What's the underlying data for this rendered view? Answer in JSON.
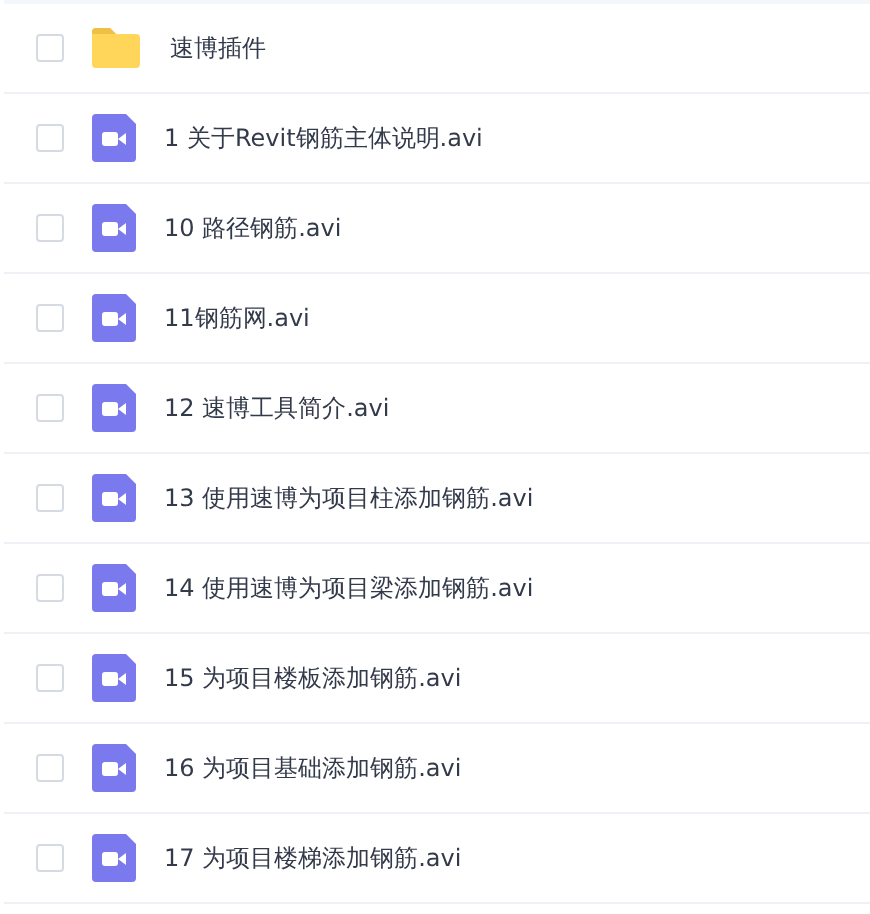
{
  "files": [
    {
      "kind": "folder",
      "name": "速博插件",
      "checked": false
    },
    {
      "kind": "video",
      "name": "1 关于Revit钢筋主体说明.avi",
      "checked": false
    },
    {
      "kind": "video",
      "name": "10 路径钢筋.avi",
      "checked": false
    },
    {
      "kind": "video",
      "name": "11钢筋网.avi",
      "checked": false
    },
    {
      "kind": "video",
      "name": "12 速博工具简介.avi",
      "checked": false
    },
    {
      "kind": "video",
      "name": "13 使用速博为项目柱添加钢筋.avi",
      "checked": false
    },
    {
      "kind": "video",
      "name": "14 使用速博为项目梁添加钢筋.avi",
      "checked": false
    },
    {
      "kind": "video",
      "name": "15 为项目楼板添加钢筋.avi",
      "checked": false
    },
    {
      "kind": "video",
      "name": "16 为项目基础添加钢筋.avi",
      "checked": false
    },
    {
      "kind": "video",
      "name": "17 为项目楼梯添加钢筋.avi",
      "checked": false
    }
  ]
}
